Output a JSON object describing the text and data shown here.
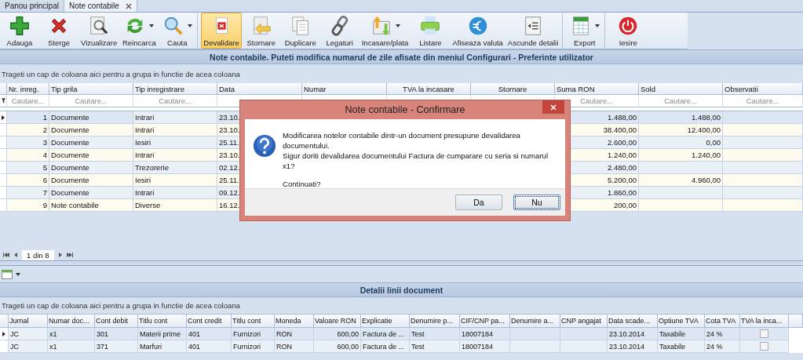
{
  "tabs": [
    {
      "label": "Panou principal",
      "selected": false,
      "closable": false
    },
    {
      "label": "Note contabile",
      "selected": true,
      "closable": true
    }
  ],
  "toolbar": [
    {
      "label": "Adauga",
      "kind": "add",
      "selected": false,
      "dropdown": false,
      "separator_after": false
    },
    {
      "label": "Sterge",
      "kind": "delete",
      "selected": false,
      "dropdown": false,
      "separator_after": false
    },
    {
      "label": "Vizualizare",
      "kind": "preview",
      "selected": false,
      "dropdown": false,
      "separator_after": false
    },
    {
      "label": "Reincarca",
      "kind": "reload",
      "selected": false,
      "dropdown": true,
      "separator_after": false
    },
    {
      "label": "Cauta",
      "kind": "search",
      "selected": false,
      "dropdown": true,
      "separator_after": true
    },
    {
      "label": "Devalidare",
      "kind": "invalidate",
      "selected": true,
      "dropdown": false,
      "separator_after": false
    },
    {
      "label": "Stornare",
      "kind": "reverse",
      "selected": false,
      "dropdown": false,
      "separator_after": false
    },
    {
      "label": "Duplicare",
      "kind": "duplicate",
      "selected": false,
      "dropdown": false,
      "separator_after": false
    },
    {
      "label": "Legaturi",
      "kind": "link",
      "selected": false,
      "dropdown": false,
      "separator_after": false
    },
    {
      "label": "Incasare/plata",
      "kind": "payment",
      "selected": false,
      "dropdown": true,
      "separator_after": false
    },
    {
      "label": "Listare",
      "kind": "print",
      "selected": false,
      "dropdown": false,
      "separator_after": false
    },
    {
      "label": "Afiseaza valuta",
      "kind": "currency",
      "selected": false,
      "dropdown": false,
      "separator_after": false
    },
    {
      "label": "Ascunde detalii",
      "kind": "details",
      "selected": false,
      "dropdown": false,
      "separator_after": true
    },
    {
      "label": "Export",
      "kind": "export",
      "selected": false,
      "dropdown": true,
      "separator_after": true
    },
    {
      "label": "Iesire",
      "kind": "exit",
      "selected": false,
      "dropdown": false,
      "separator_after": false
    }
  ],
  "banner": "Note contabile. Puteti modifica numarul de zile afisate din meniul Configurari - Preferinte utilizator",
  "main_grid": {
    "group_hint": "Trageti un cap de coloana aici pentru a grupa in functie de acea coloana",
    "columns": [
      {
        "label": "Nr. inreg.",
        "kind": "number",
        "filter": "Cautare..."
      },
      {
        "label": "Tip grila",
        "kind": "text",
        "filter": "Cautare..."
      },
      {
        "label": "Tip inregistrare",
        "kind": "text",
        "filter": "Cautare..."
      },
      {
        "label": "Data",
        "kind": "text"
      },
      {
        "label": "Numar",
        "kind": "text"
      },
      {
        "label": "TVA la incasare",
        "kind": "centered"
      },
      {
        "label": "Stornare",
        "kind": "centered"
      },
      {
        "label": "Suma RON",
        "kind": "number",
        "filter": "Cautare..."
      },
      {
        "label": "Sold",
        "kind": "number",
        "filter": "Cautare..."
      },
      {
        "label": "Observatii",
        "kind": "text",
        "filter": "Cautare..."
      }
    ],
    "rows": [
      {
        "selected": true,
        "cells": [
          "1",
          "Documente",
          "Intrari",
          "23.10.",
          null,
          null,
          null,
          "1.488,00",
          "1.488,00",
          null
        ]
      },
      {
        "selected": false,
        "cells": [
          "2",
          "Documente",
          "Intrari",
          "23.10.",
          null,
          null,
          null,
          "38.400,00",
          "12.400,00",
          null
        ]
      },
      {
        "selected": false,
        "cells": [
          "3",
          "Documente",
          "Iesiri",
          "25.11.",
          null,
          null,
          null,
          "2.600,00",
          "0,00",
          null
        ]
      },
      {
        "selected": false,
        "cells": [
          "4",
          "Documente",
          "Intrari",
          "23.10.",
          null,
          null,
          null,
          "1.240,00",
          "1.240,00",
          null
        ]
      },
      {
        "selected": false,
        "cells": [
          "5",
          "Documente",
          "Trezorerie",
          "02.12.",
          null,
          null,
          null,
          "2.480,00",
          null,
          null
        ]
      },
      {
        "selected": false,
        "cells": [
          "6",
          "Documente",
          "Iesiri",
          "25.11.",
          null,
          null,
          null,
          "5.200,00",
          "4.960,00",
          null
        ]
      },
      {
        "selected": false,
        "cells": [
          "7",
          "Documente",
          "Intrari",
          "09.12.",
          null,
          null,
          null,
          "1.860,00",
          null,
          null
        ]
      },
      {
        "selected": false,
        "cells": [
          "9",
          "Note contabile",
          "Diverse",
          "16.12.",
          null,
          null,
          null,
          "200,00",
          null,
          null
        ]
      }
    ]
  },
  "pager": {
    "page": "1 din 8"
  },
  "detail": {
    "title": "Detalii linii document",
    "group_hint": "Trageti un cap de coloana aici pentru a grupa in functie de acea coloana",
    "columns": [
      {
        "label": "Jurnal",
        "kind": "text"
      },
      {
        "label": "Numar doc...",
        "kind": "text"
      },
      {
        "label": "Cont debit",
        "kind": "text"
      },
      {
        "label": "Titlu cont",
        "kind": "text"
      },
      {
        "label": "Cont credit",
        "kind": "text"
      },
      {
        "label": "Titlu cont",
        "kind": "text"
      },
      {
        "label": "Moneda",
        "kind": "text"
      },
      {
        "label": "Valoare RON",
        "kind": "number"
      },
      {
        "label": "Explicatie",
        "kind": "text"
      },
      {
        "label": "Denumire p...",
        "kind": "text"
      },
      {
        "label": "CIF/CNP pa...",
        "kind": "text"
      },
      {
        "label": "Denumire a...",
        "kind": "text"
      },
      {
        "label": "CNP angajat",
        "kind": "text"
      },
      {
        "label": "Data scade...",
        "kind": "text"
      },
      {
        "label": "Optiune TVA",
        "kind": "text"
      },
      {
        "label": "Cota TVA",
        "kind": "text"
      },
      {
        "label": "TVA la inca...",
        "kind": "checkbox"
      }
    ],
    "rows": [
      {
        "selected": true,
        "cells": [
          "JC",
          "x1",
          "301",
          "Materii prime",
          "401",
          "Furnizori",
          "RON",
          "600,00",
          "Factura de ...",
          "Test",
          "18007184",
          null,
          null,
          "23.10.2014",
          "Taxabile",
          "24 %",
          false
        ]
      },
      {
        "selected": false,
        "cells": [
          "JC",
          "x1",
          "371",
          "Marfuri",
          "401",
          "Furnizori",
          "RON",
          "600,00",
          "Factura de ...",
          "Test",
          "18007184",
          null,
          null,
          "23.10.2014",
          "Taxabile",
          "24 %",
          false
        ]
      }
    ]
  },
  "dialog": {
    "title": "Note contabile - Confirmare",
    "paragraphs": [
      "Modificarea notelor contabile dintr-un document presupune devalidarea documentului.",
      "Sigur doriti devalidarea documentului Factura de cumparare cu seria si numarul x1?",
      "Continuati?"
    ],
    "buttons": [
      {
        "label": "Da",
        "focused": false
      },
      {
        "label": "Nu",
        "focused": true
      }
    ]
  }
}
